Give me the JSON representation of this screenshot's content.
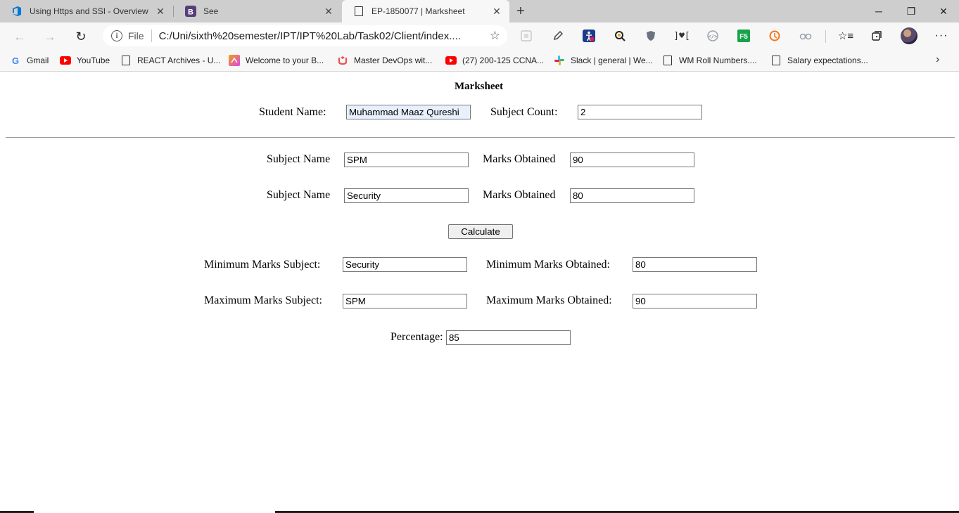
{
  "browser": {
    "tabs": [
      {
        "title": "Using Https and SSI - Overview",
        "icon": "azure-devops-icon",
        "active": false
      },
      {
        "title": "See",
        "icon": "bootstrap-icon",
        "active": false
      },
      {
        "title": "EP-1850077 | Marksheet",
        "icon": "page-icon",
        "active": true
      }
    ],
    "address": {
      "scheme_label": "File",
      "url": "C:/Uni/sixth%20semester/IPT/IPT%20Lab/Task02/Client/index...."
    },
    "bookmarks": [
      {
        "label": "Gmail",
        "icon": "google-icon"
      },
      {
        "label": "YouTube",
        "icon": "youtube-icon"
      },
      {
        "label": "REACT Archives - U...",
        "icon": "page-icon"
      },
      {
        "label": "Welcome to your B...",
        "icon": "app-icon"
      },
      {
        "label": "Master DevOps wit...",
        "icon": "udemy-icon"
      },
      {
        "label": "(27) 200-125 CCNA...",
        "icon": "youtube-icon"
      },
      {
        "label": "Slack | general | We...",
        "icon": "slack-icon"
      },
      {
        "label": "WM Roll Numbers....",
        "icon": "page-icon"
      },
      {
        "label": "Salary expectations...",
        "icon": "page-icon"
      }
    ]
  },
  "page": {
    "heading": "Marksheet",
    "student_name_label": "Student Name:",
    "student_name_value": "Muhammad Maaz Qureshi",
    "subject_count_label": "Subject Count:",
    "subject_count_value": "2",
    "subjects": [
      {
        "name_label": "Subject Name",
        "name_value": "SPM",
        "marks_label": "Marks Obtained",
        "marks_value": "90"
      },
      {
        "name_label": "Subject Name",
        "name_value": "Security",
        "marks_label": "Marks Obtained",
        "marks_value": "80"
      }
    ],
    "calculate_label": "Calculate",
    "min_subject_label": "Minimum Marks Subject:",
    "min_subject_value": "Security",
    "min_marks_label": "Minimum Marks Obtained:",
    "min_marks_value": "80",
    "max_subject_label": "Maximum Marks Subject:",
    "max_subject_value": "SPM",
    "max_marks_label": "Maximum Marks Obtained:",
    "max_marks_value": "90",
    "percentage_label": "Percentage:",
    "percentage_value": "85"
  }
}
